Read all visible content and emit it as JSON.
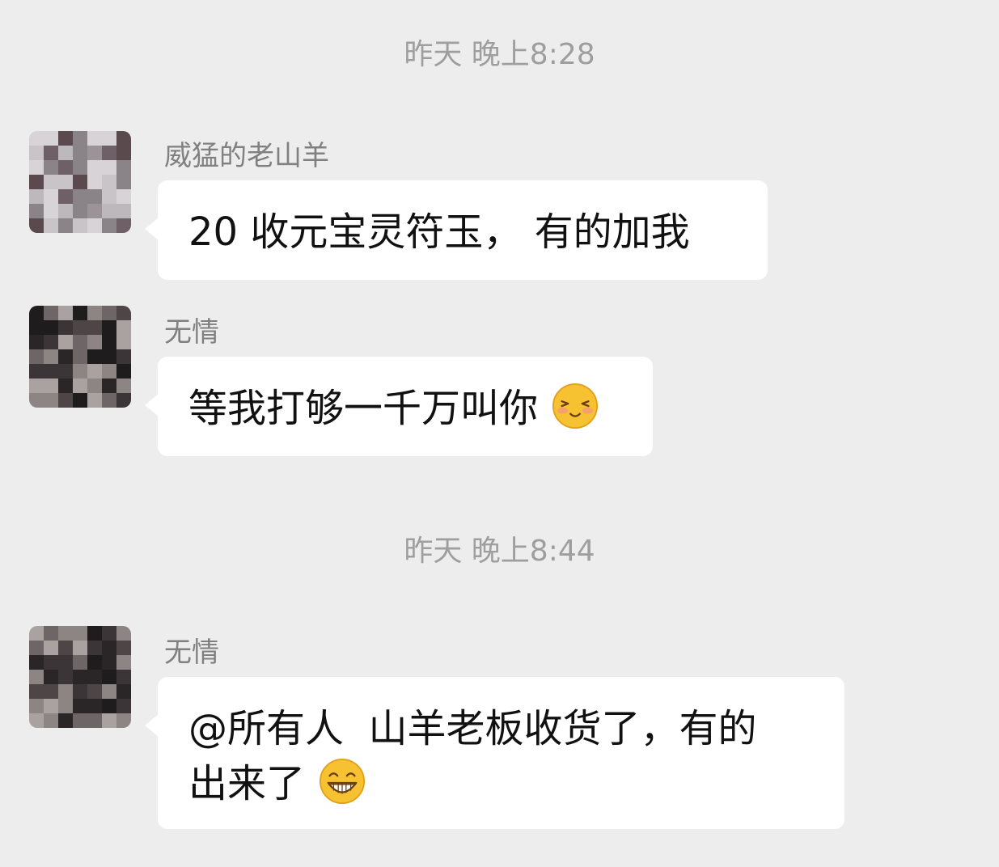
{
  "timestamps": {
    "first": "昨天 晚上8:28",
    "second": "昨天 晚上8:44"
  },
  "messages": [
    {
      "sender": "威猛的老山羊",
      "text": "20 收元宝灵符玉， 有的加我",
      "emoji": null,
      "avatar_palette": [
        "#5a4a4e",
        "#8a8388",
        "#bdb8bb",
        "#d8d3d6",
        "#6f6067",
        "#9b9397",
        "#c9c4c8"
      ]
    },
    {
      "sender": "无情",
      "text": "等我打够一千万叫你",
      "emoji": "shy-smile-emoji",
      "avatar_palette": [
        "#1f1c1d",
        "#3c3537",
        "#6e6566",
        "#a9a2a0",
        "#2a2526",
        "#8d8584",
        "#4e4646"
      ]
    },
    {
      "sender": "无情",
      "text": "@所有人  山羊老板收货了，有的\n出来了",
      "emoji": "grin-emoji",
      "avatar_palette": [
        "#1f1c1d",
        "#3c3537",
        "#6e6566",
        "#a9a2a0",
        "#2a2526",
        "#8d8584",
        "#4e4646"
      ]
    }
  ],
  "colors": {
    "background": "#ededed",
    "bubble": "#ffffff",
    "timestamp_text": "#9e9e9e",
    "sender_text": "#808080",
    "message_text": "#111111"
  }
}
